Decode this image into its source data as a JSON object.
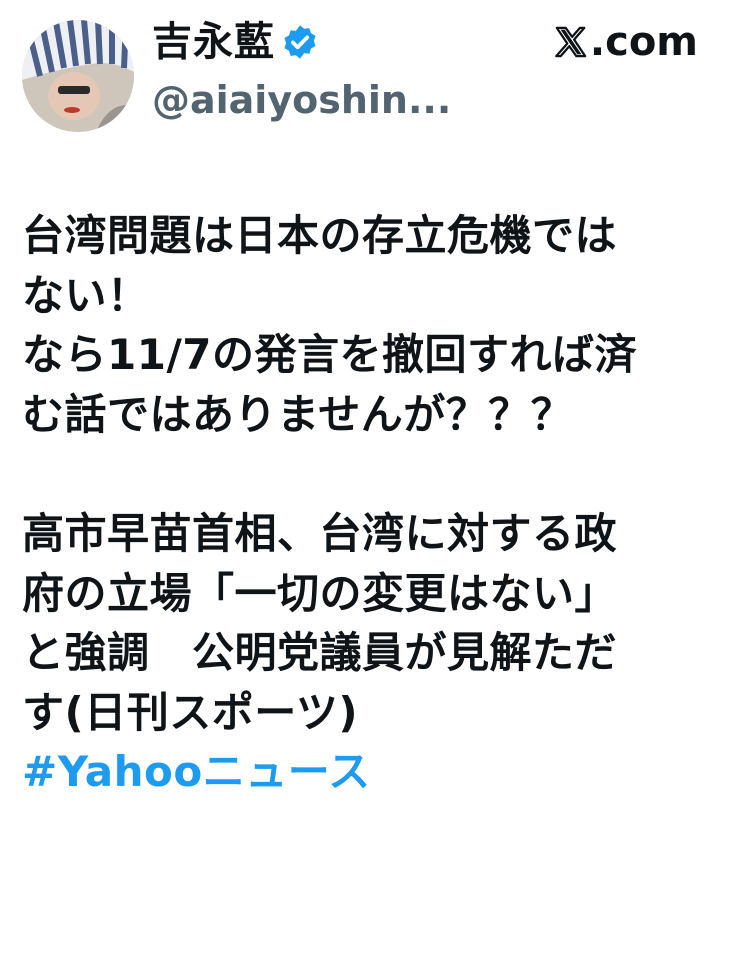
{
  "author": {
    "display_name": "吉永藍",
    "verified": true,
    "handle": "@aiaiyoshin...",
    "avatar_icon": "profile-photo-avatar"
  },
  "site": {
    "label": ".com",
    "logo_icon": "x-logo-icon"
  },
  "tweet": {
    "paragraph1": [
      "台湾問題は日本の存立危機では",
      "ない！",
      "なら11/7の発言を撤回すれば済",
      "む話ではありませんが？？？"
    ],
    "paragraph2": [
      "高市早苗首相、台湾に対する政",
      "府の立場「一切の変更はない」",
      "と強調　公明党議員が見解ただ",
      "す(日刊スポーツ)"
    ],
    "hashtag": "#Yahooニュース"
  },
  "colors": {
    "text": "#0f1419",
    "secondary": "#536471",
    "accent": "#1d9bf0"
  }
}
